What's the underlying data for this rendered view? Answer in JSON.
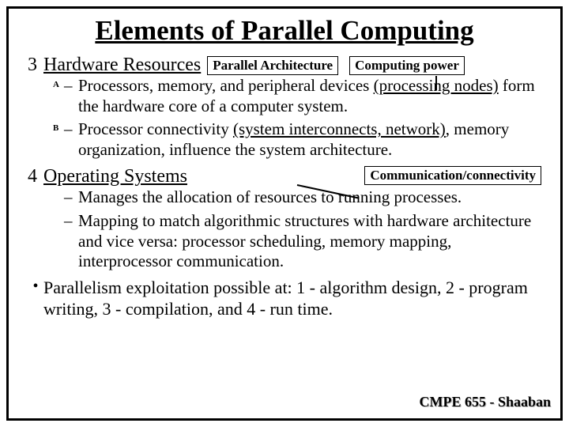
{
  "title": "Elements of Parallel Computing",
  "section3": {
    "num": "3",
    "heading": "Hardware Resources",
    "box1": "Parallel Architecture",
    "box2": "Computing power",
    "a_label": "A",
    "a_text_pre": "Processors, memory, and peripheral devices ",
    "a_text_u": "(processing nodes)",
    "a_text_post": " form the hardware core of a computer system.",
    "b_label": "B",
    "b_text_pre": "Processor connectivity ",
    "b_text_u": "(system interconnects, network)",
    "b_text_post": ", memory organization, influence the system architecture."
  },
  "section4": {
    "num": "4",
    "heading": "Operating Systems",
    "box": "Communication/connectivity",
    "item1": "Manages the allocation of resources to running processes.",
    "item2": "Mapping to match algorithmic structures with hardware architecture and vice versa: processor scheduling, memory mapping, interprocessor communication."
  },
  "bullet": {
    "mark": "•",
    "text": "Parallelism exploitation possible at:  1 - algorithm design, 2 - program writing, 3 - compilation, and 4 - run time."
  },
  "dash": "–",
  "footer": "CMPE 655 - Shaaban"
}
